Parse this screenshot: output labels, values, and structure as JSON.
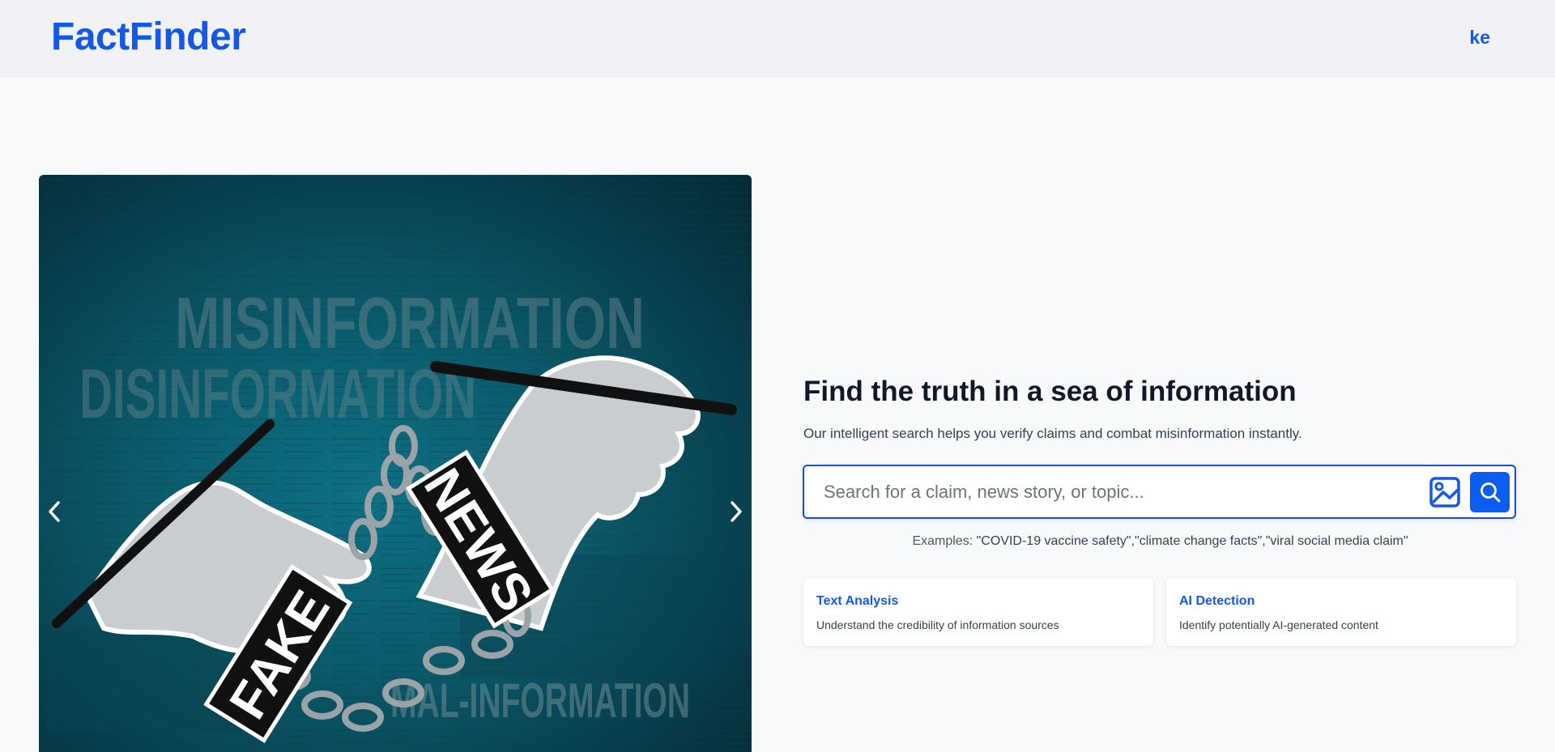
{
  "header": {
    "brand": "FactFinder",
    "user_initials": "ke"
  },
  "carousel": {
    "image_words": {
      "misinformation": "MISINFORMATION",
      "disinformation": "DISINFORMATION",
      "malinformation": "MAL-INFORMATION",
      "fake": "FAKE",
      "news": "NEWS"
    },
    "prev_icon": "chevron-left-icon",
    "next_icon": "chevron-right-icon"
  },
  "hero": {
    "headline": "Find the truth in a sea of information",
    "subline": "Our intelligent search helps you verify claims and combat misinformation instantly."
  },
  "search": {
    "placeholder": "Search for a claim, news story, or topic...",
    "value": "",
    "image_icon": "image-upload-icon",
    "search_icon": "search-icon"
  },
  "examples": {
    "label": "Examples:",
    "items": "\"COVID-19 vaccine safety\",\"climate change facts\",\"viral social media claim\""
  },
  "features": [
    {
      "title": "Text Analysis",
      "description": "Understand the credibility of information sources"
    },
    {
      "title": "AI Detection",
      "description": "Identify potentially AI-generated content"
    }
  ],
  "colors": {
    "brand": "#1557e6",
    "search_button": "#0b5cf0",
    "search_border": "#1b4fd1",
    "page_bg": "#f8f9fb",
    "header_bg": "#f1f2f6"
  }
}
